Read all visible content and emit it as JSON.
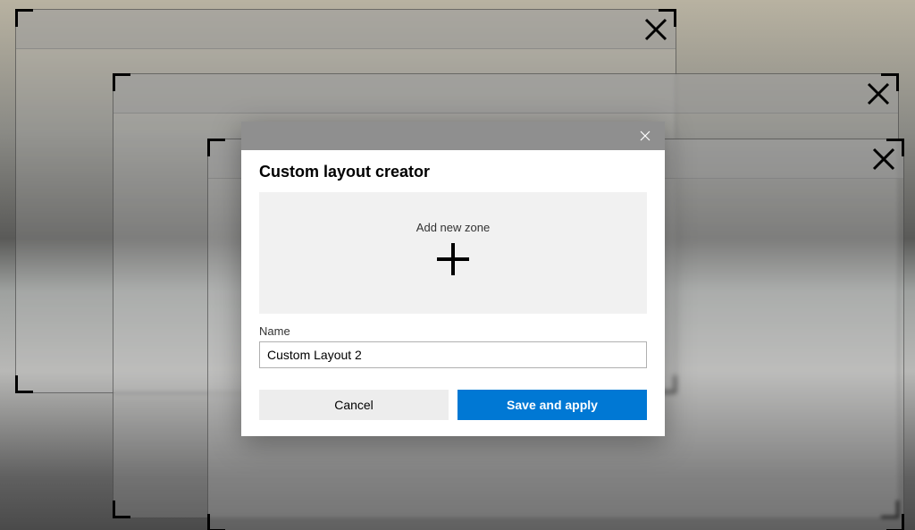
{
  "dialog": {
    "title": "Custom layout creator",
    "add_zone_label": "Add new zone",
    "name_label": "Name",
    "name_value": "Custom Layout 2",
    "cancel_label": "Cancel",
    "save_label": "Save and apply"
  }
}
